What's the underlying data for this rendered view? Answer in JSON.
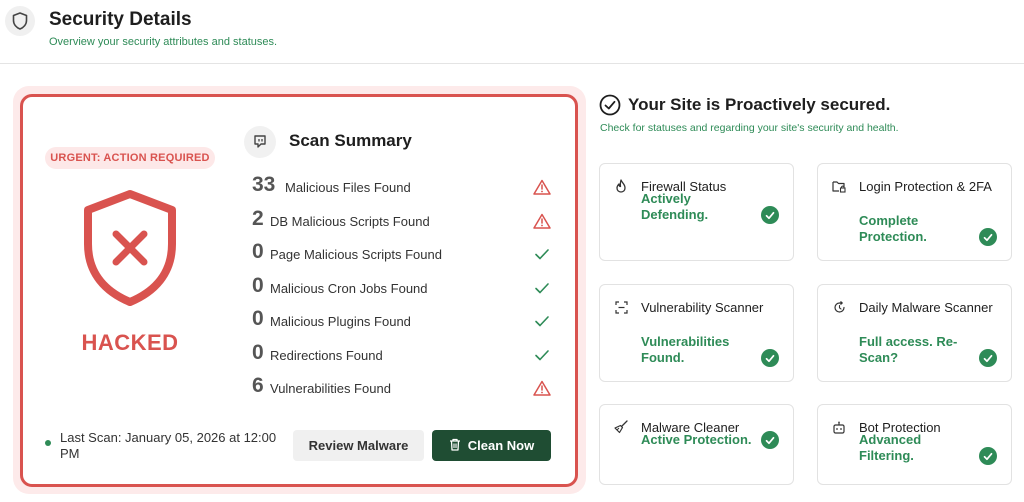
{
  "header": {
    "title": "Security Details",
    "subtitle": "Overview your security attributes and statuses."
  },
  "status_card": {
    "urgent_label": "URGENT: ACTION REQUIRED",
    "status": "HACKED",
    "last_scan": "Last Scan: January 05, 2026 at 12:00 PM",
    "review_button": "Review Malware",
    "clean_button": "Clean Now"
  },
  "scan_summary": {
    "title": "Scan Summary",
    "items": [
      {
        "count": "33",
        "label": "Malicious Files Found",
        "status": "warning"
      },
      {
        "count": "2",
        "label": "DB Malicious Scripts Found",
        "status": "warning"
      },
      {
        "count": "0",
        "label": "Page Malicious Scripts Found",
        "status": "ok"
      },
      {
        "count": "0",
        "label": "Malicious Cron Jobs Found",
        "status": "ok"
      },
      {
        "count": "0",
        "label": "Malicious Plugins Found",
        "status": "ok"
      },
      {
        "count": "0",
        "label": "Redirections Found",
        "status": "ok"
      },
      {
        "count": "6",
        "label": "Vulnerabilities Found",
        "status": "warning"
      }
    ]
  },
  "secured": {
    "title": "Your Site is Proactively secured.",
    "subtitle": "Check for statuses and regarding your site's security and health."
  },
  "features": [
    {
      "name": "Firewall Status",
      "status": "Actively Defending.",
      "icon": "flame-icon"
    },
    {
      "name": "Login Protection & 2FA",
      "status": "Complete Protection.",
      "icon": "folder-lock-icon"
    },
    {
      "name": "Vulnerability Scanner",
      "status": "Vulnerabilities Found.",
      "icon": "scan-icon"
    },
    {
      "name": "Daily Malware Scanner",
      "status": "Full access. Re-Scan?",
      "icon": "refresh-icon"
    },
    {
      "name": "Malware Cleaner",
      "status": "Active Protection.",
      "icon": "brush-icon"
    },
    {
      "name": "Bot Protection",
      "status": "Advanced Filtering.",
      "icon": "bot-icon"
    }
  ],
  "colors": {
    "danger": "#d9534f",
    "success": "#2e8b57",
    "primary_button": "#1f4d33"
  }
}
